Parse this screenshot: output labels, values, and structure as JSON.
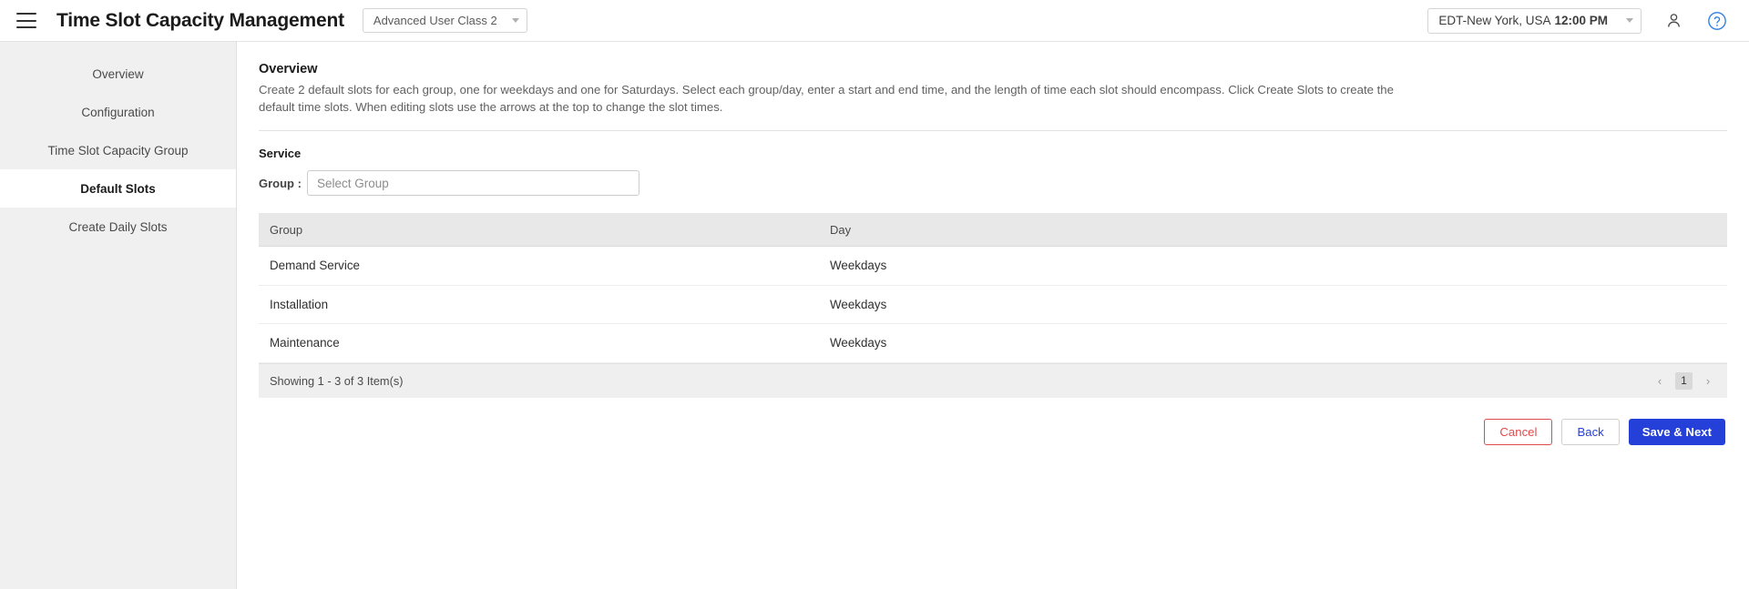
{
  "topbar": {
    "menu_icon": "hamburger-menu-icon",
    "title": "Time Slot Capacity Management",
    "user_class": {
      "value": "Advanced User Class 2",
      "caret_icon": "chevron-down-icon"
    },
    "timezone": {
      "label": "EDT-New York, USA",
      "time": "12:00 PM",
      "caret_icon": "chevron-down-icon"
    },
    "profile_icon": "person-icon",
    "help_icon": "question-mark-circle-icon"
  },
  "sidebar": {
    "items": [
      {
        "label": "Overview",
        "active": false
      },
      {
        "label": "Configuration",
        "active": false
      },
      {
        "label": "Time Slot Capacity Group",
        "active": false
      },
      {
        "label": "Default Slots",
        "active": true
      },
      {
        "label": "Create Daily Slots",
        "active": false
      }
    ]
  },
  "main": {
    "heading": "Overview",
    "description": "Create 2 default slots for each group, one for weekdays and one for Saturdays. Select each group/day, enter a start and end time, and the length of time each slot should encompass. Click Create Slots to create the default time slots. When editing slots use the arrows at the top to change the slot times.",
    "service_label": "Service",
    "group_field": {
      "label": "Group :",
      "value": "",
      "placeholder": "Select Group"
    },
    "table": {
      "columns": [
        "Group",
        "Day"
      ],
      "rows": [
        {
          "group": "Demand Service",
          "day": "Weekdays"
        },
        {
          "group": "Installation",
          "day": "Weekdays"
        },
        {
          "group": "Maintenance",
          "day": "Weekdays"
        }
      ],
      "footer_text": "Showing 1 - 3 of 3 Item(s)",
      "pagination": {
        "prev": "‹",
        "current_page": "1",
        "next": "›"
      }
    },
    "actions": {
      "cancel": "Cancel",
      "back": "Back",
      "save_next": "Save & Next"
    }
  },
  "colors": {
    "primary": "#2540d8",
    "danger": "#e04a4a",
    "sidebar_bg": "#f0f0f0",
    "table_head_bg": "#e8e8e8",
    "help_icon": "#2e7fe0"
  }
}
